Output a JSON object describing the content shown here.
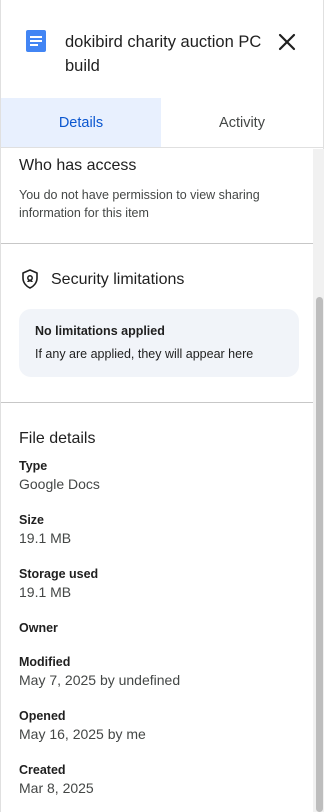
{
  "header": {
    "title": "dokibird charity auction PC build",
    "doc_icon": "google-docs-icon",
    "close_icon": "close-icon",
    "doc_color": "#4285f4"
  },
  "tabs": [
    {
      "label": "Details",
      "active": true
    },
    {
      "label": "Activity",
      "active": false
    }
  ],
  "access": {
    "title": "Who has access",
    "text": "You do not have permission to view sharing information for this item"
  },
  "security": {
    "title": "Security limitations",
    "icon": "shield-lock-icon",
    "box_title": "No limitations applied",
    "box_text": "If any are applied, they will appear here"
  },
  "file_details": {
    "title": "File details",
    "fields": [
      {
        "label": "Type",
        "value": "Google Docs"
      },
      {
        "label": "Size",
        "value": "19.1 MB"
      },
      {
        "label": "Storage used",
        "value": "19.1 MB"
      },
      {
        "label": "Owner",
        "value": ""
      },
      {
        "label": "Modified",
        "value": "May 7, 2025 by undefined"
      },
      {
        "label": "Opened",
        "value": "May 16, 2025 by me"
      },
      {
        "label": "Created",
        "value": "Mar 8, 2025"
      }
    ]
  },
  "colors": {
    "accent": "#0b57d0",
    "tab_active_bg": "#e8f0fe",
    "box_bg": "#f1f4f9"
  }
}
